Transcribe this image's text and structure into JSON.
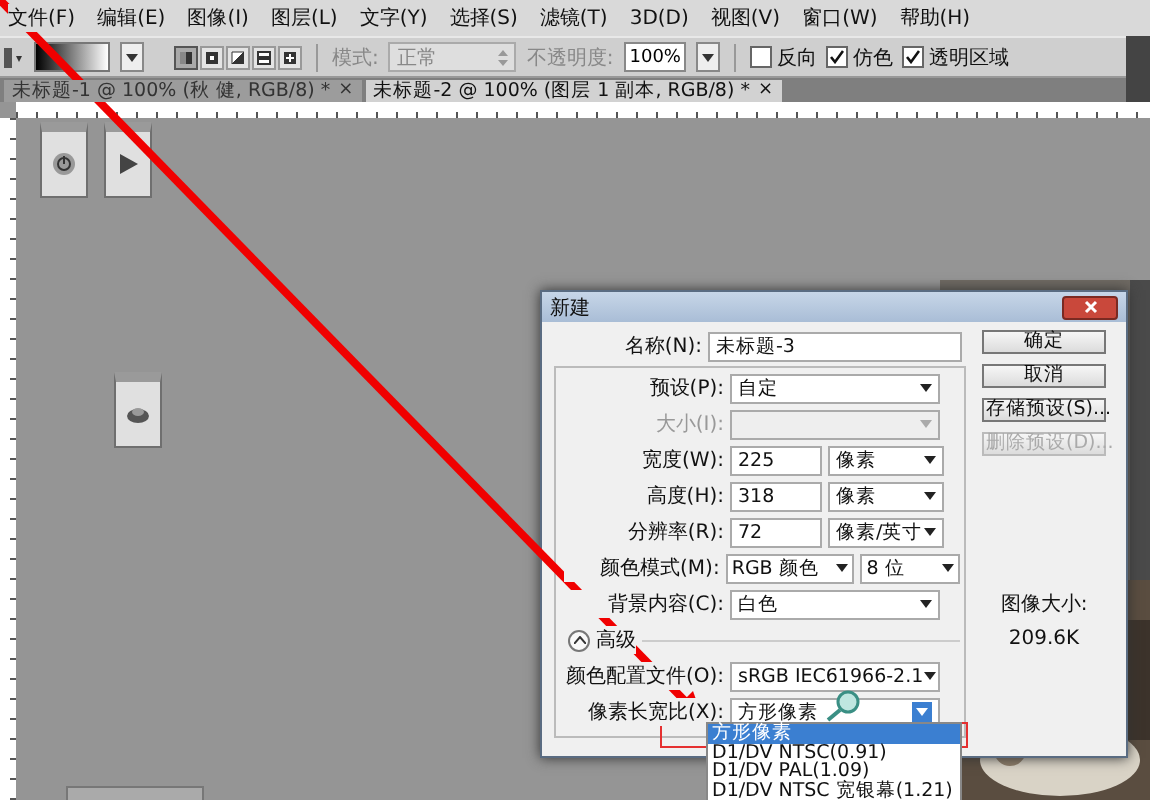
{
  "menu_bar": {
    "items": [
      "文件(F)",
      "编辑(E)",
      "图像(I)",
      "图层(L)",
      "文字(Y)",
      "选择(S)",
      "滤镜(T)",
      "3D(D)",
      "视图(V)",
      "窗口(W)",
      "帮助(H)"
    ]
  },
  "options_bar": {
    "gradient_types": [
      {
        "selected": true
      },
      {
        "selected": false
      },
      {
        "selected": false
      },
      {
        "selected": false
      },
      {
        "selected": false
      }
    ],
    "mode_label": "模式:",
    "mode_value": "正常",
    "opacity_label": "不透明度:",
    "opacity_value": "100%",
    "checkboxes": [
      {
        "label": "反向",
        "checked": false
      },
      {
        "label": "仿色",
        "checked": true
      },
      {
        "label": "透明区域",
        "checked": true
      }
    ]
  },
  "document_tabs": [
    {
      "label": "未标题-1 @ 100% (秋 健, RGB/8) *",
      "close": "×",
      "selected": false
    },
    {
      "label": "未标题-2 @ 100% (图层 1 副本, RGB/8) *",
      "close": "×",
      "selected": true
    }
  ],
  "dialog": {
    "title": "新建",
    "name_row": {
      "label": "名称(N):",
      "value": "未标题-3"
    },
    "preset_rows": [
      {
        "kind": "select",
        "label": "预设(P):",
        "value": "自定",
        "disabled": false
      },
      {
        "kind": "select",
        "label": "大小(I):",
        "disabled": true
      },
      {
        "kind": "pair",
        "label": "宽度(W):",
        "value": "225",
        "unit": "像素",
        "disabled": false
      },
      {
        "kind": "pair",
        "label": "高度(H):",
        "value": "318",
        "unit": "像素",
        "disabled": false
      },
      {
        "kind": "pair",
        "label": "分辨率(R):",
        "value": "72",
        "unit": "像素/英寸",
        "disabled": false
      },
      {
        "kind": "select_pair",
        "label": "颜色模式(M):",
        "value": "RGB 颜色",
        "unit": "8 位",
        "disabled": false
      },
      {
        "kind": "select",
        "label": "背景内容(C):",
        "value": "白色",
        "disabled": false
      },
      {
        "kind": "toggle",
        "label": "高级",
        "expanded": true
      },
      {
        "kind": "select",
        "label": "颜色配置文件(O):",
        "value": "sRGB IEC61966-2.1",
        "disabled": false
      },
      {
        "kind": "select",
        "label": "像素长宽比(X):",
        "value": "方形像素",
        "disabled": false,
        "open": true
      }
    ],
    "dropdown_options": [
      {
        "label": "方形像素",
        "selected": true
      },
      {
        "label": "D1/DV NTSC(0.91)",
        "selected": false
      },
      {
        "label": "D1/DV PAL(1.09)",
        "selected": false
      },
      {
        "label": "D1/DV NTSC 宽银幕(1.21)",
        "selected": false
      }
    ],
    "buttons": [
      {
        "label": "确定",
        "disabled": false
      },
      {
        "label": "取消",
        "disabled": false
      },
      {
        "label": "存储预设(S)...",
        "disabled": false
      },
      {
        "label": "删除预设(D)...",
        "disabled": true
      }
    ],
    "image_size": {
      "label": "图像大小:",
      "value": "209.6K"
    }
  }
}
